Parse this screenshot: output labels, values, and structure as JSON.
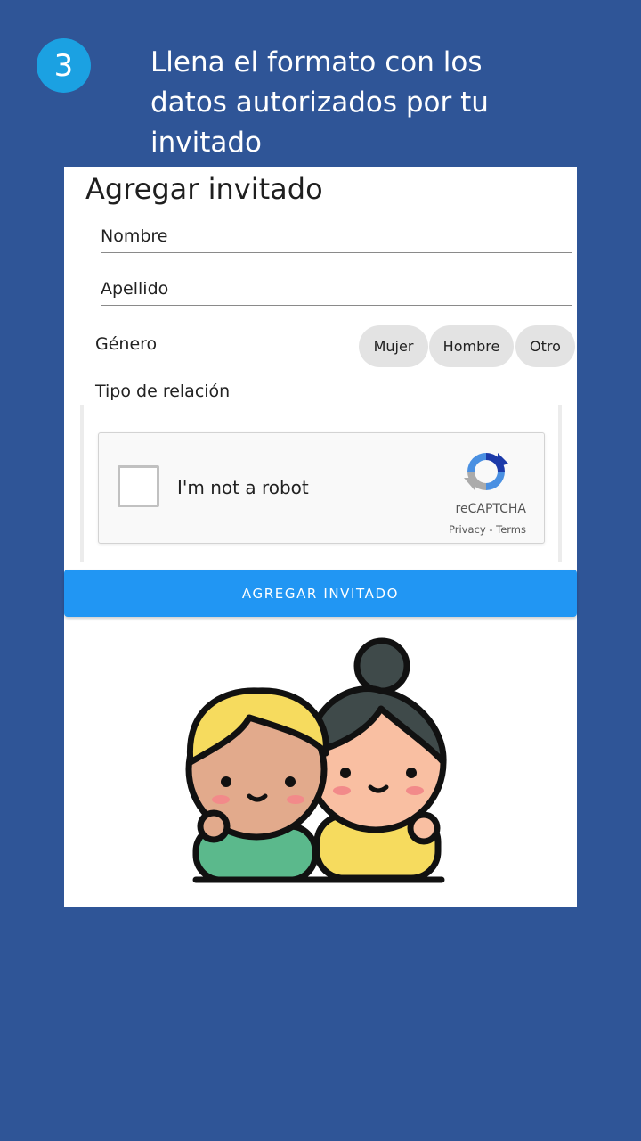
{
  "step": {
    "number": "3",
    "color": "#1ba1e2"
  },
  "instruction": "Llena el formato con los datos autorizados por tu invitado",
  "form": {
    "title": "Agregar invitado",
    "fields": {
      "nombre_placeholder": "Nombre",
      "apellido_placeholder": "Apellido"
    },
    "genero_label": "Género",
    "genero_options": [
      "Mujer",
      "Hombre",
      "Otro"
    ],
    "tipo_relacion_label": "Tipo de relación",
    "recaptcha": {
      "checkbox_label": "I'm not a robot",
      "brand": "reCAPTCHA",
      "links": "Privacy - Terms"
    },
    "submit_label": "AGREGAR INVITADO",
    "accent_color": "#2196f3"
  },
  "colors": {
    "background": "#2f5597",
    "card": "#ffffff"
  },
  "illustration": {
    "icon": "two-people-couple-icon"
  }
}
